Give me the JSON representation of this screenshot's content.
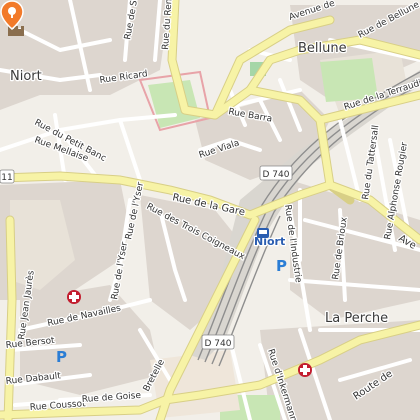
{
  "map": {
    "places": {
      "niort": "Niort",
      "bellune": "Bellune",
      "la_perche": "La Perche",
      "station": "Niort"
    },
    "route_refs": {
      "d740_a": "D 740",
      "d740_b": "D 740",
      "d11": "11"
    },
    "streets": {
      "rue_de_la_gare": "Rue de la Gare",
      "rue_des_trois_coigneaux": "Rue des Trois Coigneaux",
      "rue_de_l_yser": "Rue de l'Yser",
      "rue_de_l_yser_2": "Rue de l'Yser",
      "rue_viala": "Rue Viala",
      "rue_barra": "Rue Barra",
      "rue_ricard": "Rue Ricard",
      "rue_du_petit_banc": "Rue du Petit Banc",
      "rue_mellaise": "Rue Mellaise",
      "rue_de_navailles": "Rue de Navailles",
      "rue_bersot": "Rue Bersot",
      "rue_dabault": "Rue Dabault",
      "rue_coussot": "Rue Coussot",
      "rue_de_goise": "Rue de Goise",
      "rue_jean_jaures": "Rue Jean Jaurès",
      "rue_de_l_industrie": "Rue de l'Industrie",
      "rue_de_brioux": "Rue de Brioux",
      "rue_du_tattersall": "Rue du Tattersall",
      "rue_alphonse_rouger": "Rue Alphonse Rougier",
      "rue_du_limousin": "Rue du Limousin",
      "rue_de_la_terraudiere": "Rue de la Terraudière",
      "rue_de_bellune": "Rue de Bellune",
      "avenue_de": "Avenue de",
      "rue_de_ren": "Rue du Ren",
      "rue_d_inkermann": "Rue d'Inkermann",
      "route_de": "Route de",
      "ave": "Ave",
      "bretelle": "Bretelle",
      "rue_de_strasbourg": "Rue de Strasbourg"
    },
    "icons": [
      "location-marker-icon",
      "hospital-icon",
      "parking-icon",
      "train-station-icon",
      "castle-icon"
    ],
    "colors": {
      "background": "#f2efe9",
      "main_road": "#f7f3a6",
      "minor_road": "#ffffff",
      "building": "#d9d0c9",
      "park": "#c8e6b4",
      "railway": "#8e8e8e",
      "marker": "#f27a2a",
      "hospital": "#c21d2f",
      "parking": "#2a7dd5",
      "station": "#2a5db0"
    }
  }
}
